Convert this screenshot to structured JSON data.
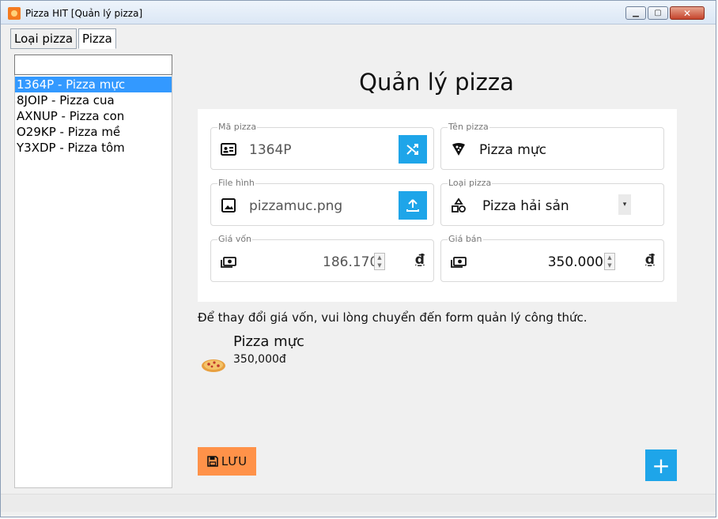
{
  "window": {
    "title": "Pizza HIT [Quản lý pizza]",
    "controls": [
      "minimize",
      "maximize",
      "close"
    ]
  },
  "tabs": [
    {
      "label": "Loại pizza",
      "active": false
    },
    {
      "label": "Pizza",
      "active": true
    }
  ],
  "sidebar": {
    "search_value": "",
    "items": [
      {
        "label": "1364P - Pizza mực",
        "selected": true
      },
      {
        "label": "8JOIP - Pizza cua",
        "selected": false
      },
      {
        "label": "AXNUP - Pizza con",
        "selected": false
      },
      {
        "label": "O29KP - Pizza mề",
        "selected": false
      },
      {
        "label": "Y3XDP - Pizza tôm",
        "selected": false
      }
    ]
  },
  "main": {
    "heading": "Quản lý pizza",
    "fields": {
      "code": {
        "label": "Mã pizza",
        "value": "1364P",
        "icon": "id-card-icon",
        "action": "shuffle-icon"
      },
      "name": {
        "label": "Tên pizza",
        "value": "Pizza mực",
        "icon": "pizza-slice-icon"
      },
      "image": {
        "label": "File hình",
        "value": "pizzamuc.png",
        "icon": "image-icon",
        "action": "upload-icon"
      },
      "category": {
        "label": "Loại pizza",
        "value": "Pizza hải sản",
        "icon": "shapes-icon"
      },
      "cost": {
        "label": "Giá vốn",
        "value": "186.170",
        "currency": "₫",
        "icon": "money-icon"
      },
      "price": {
        "label": "Giá bán",
        "value": "350.000",
        "currency": "₫",
        "icon": "money-icon"
      }
    },
    "note": "Để thay đổi giá vốn, vui lòng chuyển đến form quản lý công thức.",
    "preview": {
      "name": "Pizza mực",
      "price": "350,000đ"
    },
    "save_label": "LƯU",
    "add_label": "+"
  },
  "colors": {
    "accent_blue": "#1ea5e9",
    "save_orange": "#ff9249",
    "selection_blue": "#3399ff"
  }
}
